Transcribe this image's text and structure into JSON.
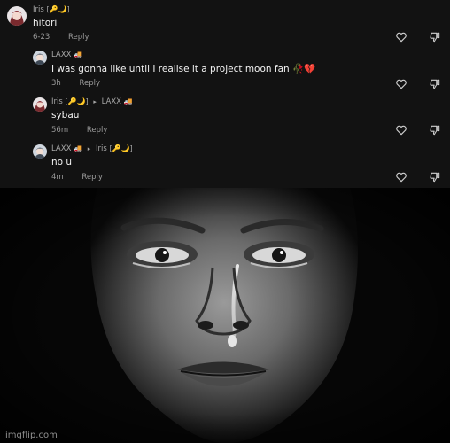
{
  "comments": [
    {
      "user": "Iris",
      "user_badge": "[🔑🌙]",
      "reply_to": "",
      "reply_to_badge": "",
      "text": "hitori",
      "time": "6-23",
      "reply_label": "Reply",
      "avatar_icon": "anime-avatar-icon"
    },
    {
      "user": "LAXX",
      "user_badge": "🚚",
      "reply_to": "",
      "reply_to_badge": "",
      "text": "I was gonna like until I realise it a project moon fan 🥀💔",
      "time": "3h",
      "reply_label": "Reply",
      "avatar_icon": "anime-avatar-icon"
    },
    {
      "user": "Iris",
      "user_badge": "[🔑🌙]",
      "reply_to": "LAXX",
      "reply_to_badge": "🚚",
      "text": "sybau",
      "time": "56m",
      "reply_label": "Reply",
      "avatar_icon": "anime-avatar-icon"
    },
    {
      "user": "LAXX",
      "user_badge": "🚚",
      "reply_to": "Iris",
      "reply_to_badge": "[🔑🌙]",
      "text": "no u",
      "time": "4m",
      "reply_label": "Reply",
      "avatar_icon": "anime-avatar-icon"
    }
  ],
  "icons": {
    "like": "heart-icon",
    "dislike": "thumbs-down-icon",
    "reply_arrow": "▸"
  },
  "watermark": "imgflip.com",
  "colors": {
    "comment_bg": "#121212",
    "text": "#f2f2f2",
    "muted": "#a7a7a7"
  }
}
